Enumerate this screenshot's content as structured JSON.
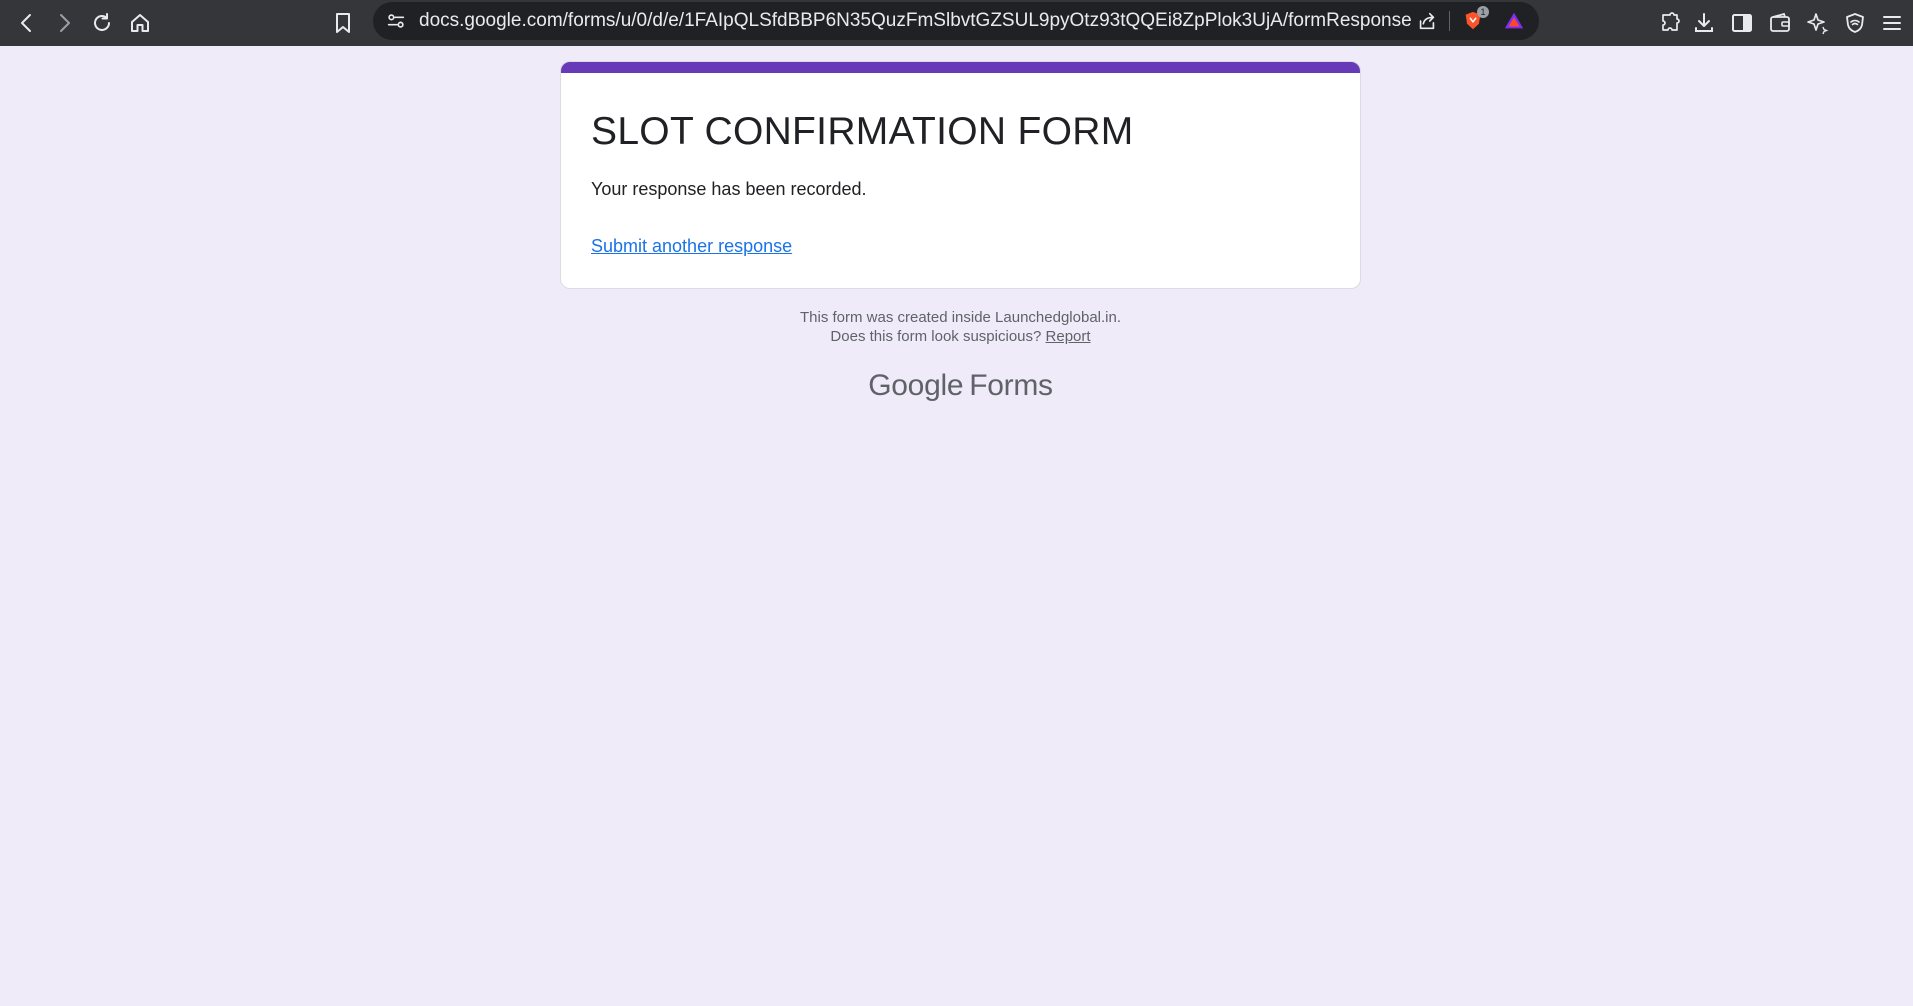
{
  "browser": {
    "url": "docs.google.com/forms/u/0/d/e/1FAIpQLSfdBBP6N35QuzFmSlbvtGZSUL9pyOtz93tQQEi8ZpPlok3UjA/formResponse",
    "shield_badge": "1",
    "icons": [
      "back-icon",
      "forward-icon",
      "reload-icon",
      "home-icon",
      "bookmark-icon",
      "site-settings-icon",
      "share-icon",
      "brave-shield-icon",
      "brave-rewards-icon",
      "extensions-icon",
      "download-icon",
      "sidebar-icon",
      "wallet-icon",
      "leo-ai-icon",
      "vpn-icon",
      "menu-icon"
    ]
  },
  "form": {
    "title": "SLOT CONFIRMATION FORM",
    "confirmation": "Your response has been recorded.",
    "submit_another": "Submit another response",
    "accent_color": "#673ab7"
  },
  "footer": {
    "created_inside": "This form was created inside Launchedglobal.in.",
    "suspicious": "Does this form look suspicious?",
    "report": "Report",
    "logo_google": "Google",
    "logo_forms": "Forms"
  }
}
